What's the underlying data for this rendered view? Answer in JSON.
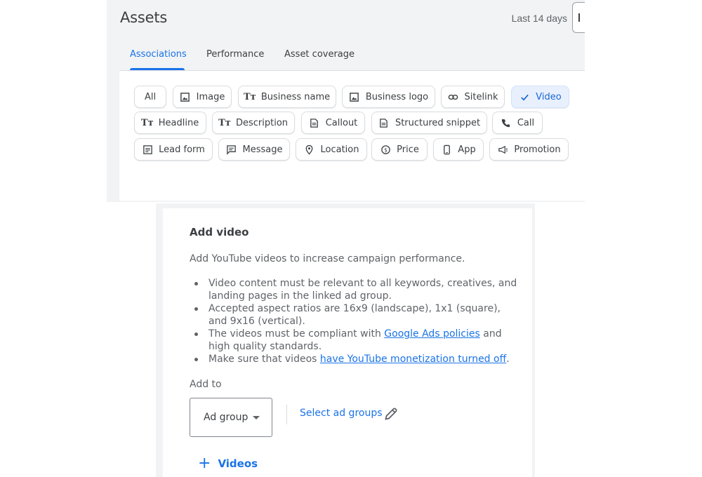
{
  "header": {
    "title": "Assets",
    "date_range": "Last 14 days"
  },
  "tabs": [
    {
      "label": "Associations",
      "active": true
    },
    {
      "label": "Performance",
      "active": false
    },
    {
      "label": "Asset coverage",
      "active": false
    }
  ],
  "chips": {
    "all": "All",
    "image": "Image",
    "business_name": "Business name",
    "business_logo": "Business logo",
    "sitelink": "Sitelink",
    "video": "Video",
    "headline": "Headline",
    "description": "Description",
    "callout": "Callout",
    "structured_snippet": "Structured snippet",
    "call": "Call",
    "lead_form": "Lead form",
    "message": "Message",
    "location": "Location",
    "price": "Price",
    "app": "App",
    "promotion": "Promotion",
    "selected": "Video"
  },
  "dialog": {
    "title": "Add video",
    "description": "Add YouTube videos to increase campaign performance.",
    "bullets": {
      "b1": "Video content must be relevant to all keywords, creatives, and landing pages in the linked ad group.",
      "b2": "Accepted aspect ratios are 16x9 (landscape), 1x1 (square), and 9x16 (vertical).",
      "b3_pre": "The videos must be compliant with ",
      "b3_link": "Google Ads policies",
      "b3_post": " and high quality standards.",
      "b4_pre": "Make sure that videos ",
      "b4_link": "have YouTube monetization turned off",
      "b4_post": "."
    },
    "add_to_label": "Add to",
    "select_value": "Ad group",
    "select_link": "Select ad groups",
    "add_button_plus": "+",
    "add_button_label": "Videos"
  },
  "colors": {
    "accent": "#1a73e8",
    "selected_chip_bg": "#e8f0fe",
    "panel_bg": "#f1f3f4"
  }
}
